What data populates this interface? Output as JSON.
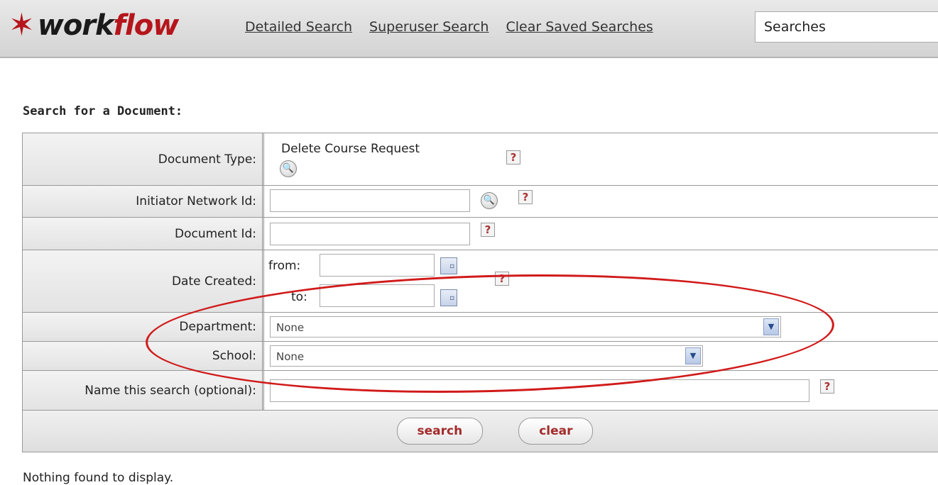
{
  "header": {
    "logo_star": "✶",
    "logo_word_1": "work",
    "logo_word_2": "flow",
    "links": [
      "Detailed Search",
      "Superuser Search",
      "Clear Saved Searches"
    ],
    "searches_value": "Searches"
  },
  "title": "Search for a Document:",
  "form": {
    "document_type_label": "Document Type:",
    "document_type_value": "Delete Course Request",
    "initiator_label": "Initiator Network Id:",
    "initiator_value": "",
    "document_id_label": "Document Id:",
    "document_id_value": "",
    "date_created_label": "Date Created:",
    "from_label": "from:",
    "to_label": "to:",
    "from_value": "",
    "to_value": "",
    "department_label": "Department:",
    "department_value": "None",
    "school_label": "School:",
    "school_value": "None",
    "name_search_label": "Name this search (optional):",
    "name_search_value": "",
    "help_glyph": "?"
  },
  "buttons": {
    "search": "search",
    "clear": "clear"
  },
  "result_message": "Nothing found to display.",
  "colors": {
    "brand": "#b5151b",
    "annotation": "#d11a1a"
  }
}
